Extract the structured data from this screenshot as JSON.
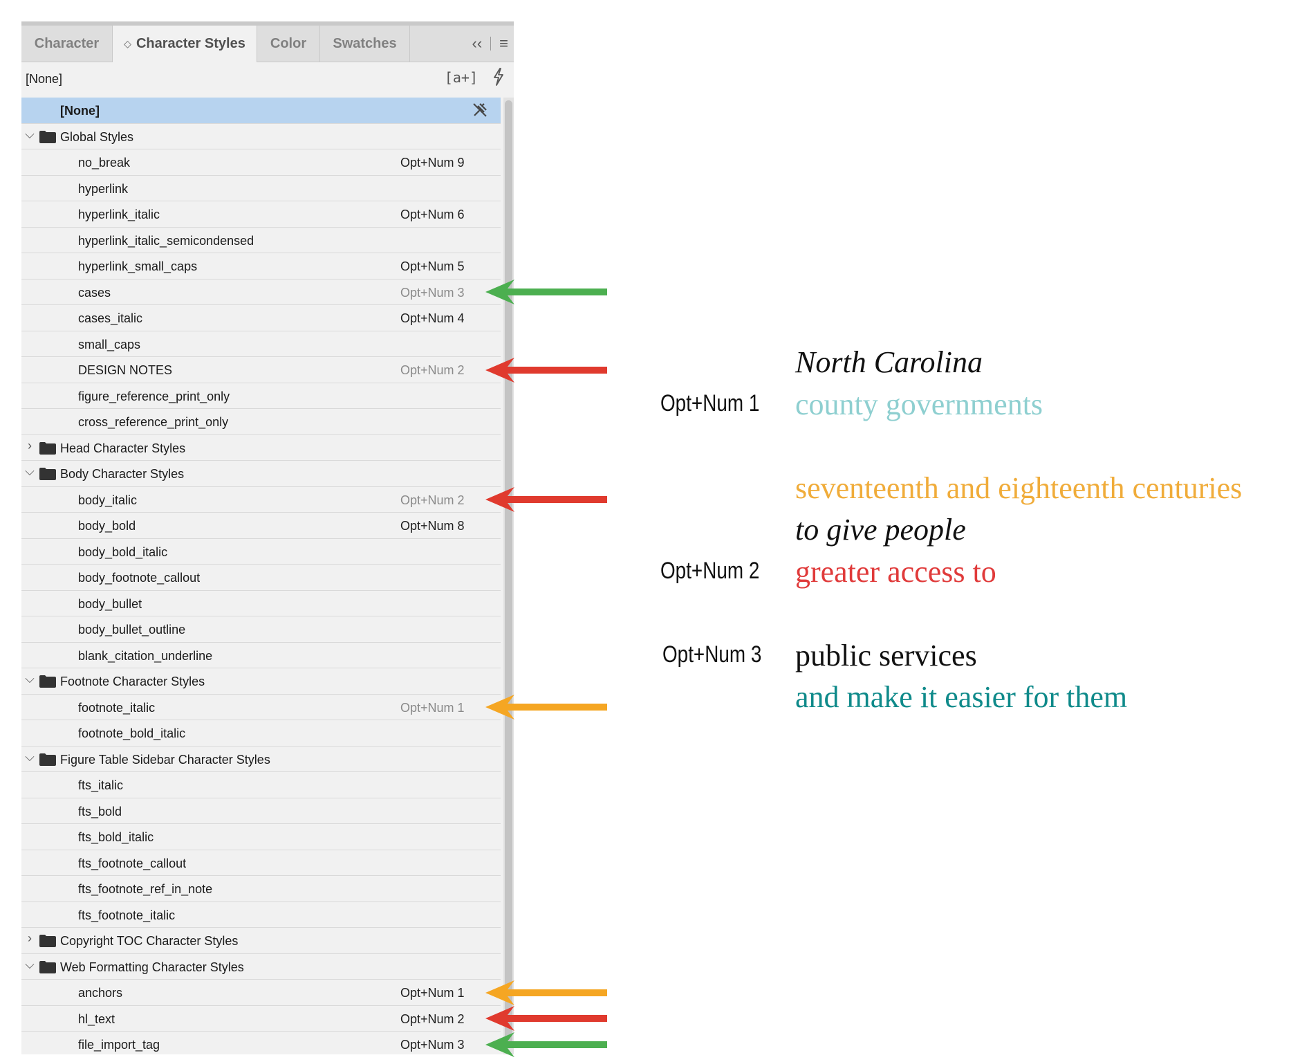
{
  "panel": {
    "tabs": [
      {
        "label": "Character",
        "active": false
      },
      {
        "label": "Character Styles",
        "active": true
      },
      {
        "label": "Color",
        "active": false
      },
      {
        "label": "Swatches",
        "active": false
      }
    ],
    "collapse_glyph": "‹‹",
    "menu_glyph": "≡",
    "current_style": "[None]",
    "new_style_glyph": "[a+]",
    "rows": [
      {
        "kind": "none",
        "label": "[None]",
        "selected": true
      },
      {
        "kind": "group",
        "label": "Global Styles",
        "expanded": true
      },
      {
        "kind": "style",
        "label": "no_break",
        "shortcut": "Opt+Num 9"
      },
      {
        "kind": "style",
        "label": "hyperlink",
        "shortcut": ""
      },
      {
        "kind": "style",
        "label": "hyperlink_italic",
        "shortcut": "Opt+Num 6"
      },
      {
        "kind": "style",
        "label": "hyperlink_italic_semicondensed",
        "shortcut": ""
      },
      {
        "kind": "style",
        "label": "hyperlink_small_caps",
        "shortcut": "Opt+Num 5"
      },
      {
        "kind": "style",
        "label": "cases",
        "shortcut": "Opt+Num 3",
        "dimmed": true
      },
      {
        "kind": "style",
        "label": "cases_italic",
        "shortcut": "Opt+Num 4"
      },
      {
        "kind": "style",
        "label": "small_caps",
        "shortcut": ""
      },
      {
        "kind": "style",
        "label": "DESIGN NOTES",
        "shortcut": "Opt+Num 2",
        "dimmed": true
      },
      {
        "kind": "style",
        "label": "figure_reference_print_only",
        "shortcut": ""
      },
      {
        "kind": "style",
        "label": "cross_reference_print_only",
        "shortcut": ""
      },
      {
        "kind": "group",
        "label": "Head Character Styles",
        "expanded": false
      },
      {
        "kind": "group",
        "label": "Body Character Styles",
        "expanded": true
      },
      {
        "kind": "style",
        "label": "body_italic",
        "shortcut": "Opt+Num 2",
        "dimmed": true
      },
      {
        "kind": "style",
        "label": "body_bold",
        "shortcut": "Opt+Num 8"
      },
      {
        "kind": "style",
        "label": "body_bold_italic",
        "shortcut": ""
      },
      {
        "kind": "style",
        "label": "body_footnote_callout",
        "shortcut": ""
      },
      {
        "kind": "style",
        "label": "body_bullet",
        "shortcut": ""
      },
      {
        "kind": "style",
        "label": "body_bullet_outline",
        "shortcut": ""
      },
      {
        "kind": "style",
        "label": "blank_citation_underline",
        "shortcut": ""
      },
      {
        "kind": "group",
        "label": "Footnote Character Styles",
        "expanded": true
      },
      {
        "kind": "style",
        "label": "footnote_italic",
        "shortcut": "Opt+Num 1",
        "dimmed": true
      },
      {
        "kind": "style",
        "label": "footnote_bold_italic",
        "shortcut": ""
      },
      {
        "kind": "group",
        "label": "Figure Table Sidebar Character Styles",
        "expanded": true
      },
      {
        "kind": "style",
        "label": "fts_italic",
        "shortcut": ""
      },
      {
        "kind": "style",
        "label": "fts_bold",
        "shortcut": ""
      },
      {
        "kind": "style",
        "label": "fts_bold_italic",
        "shortcut": ""
      },
      {
        "kind": "style",
        "label": "fts_footnote_callout",
        "shortcut": ""
      },
      {
        "kind": "style",
        "label": "fts_footnote_ref_in_note",
        "shortcut": ""
      },
      {
        "kind": "style",
        "label": "fts_footnote_italic",
        "shortcut": ""
      },
      {
        "kind": "group",
        "label": "Copyright TOC Character Styles",
        "expanded": false
      },
      {
        "kind": "group",
        "label": "Web Formatting Character Styles",
        "expanded": true
      },
      {
        "kind": "style",
        "label": "anchors",
        "shortcut": "Opt+Num 1"
      },
      {
        "kind": "style",
        "label": "hl_text",
        "shortcut": "Opt+Num 2"
      },
      {
        "kind": "style",
        "label": "file_import_tag",
        "shortcut": "Opt+Num 3"
      }
    ]
  },
  "arrows": [
    {
      "row": 7,
      "color": "#4caf50"
    },
    {
      "row": 10,
      "color": "#e03a2e"
    },
    {
      "row": 15,
      "color": "#e03a2e"
    },
    {
      "row": 23,
      "color": "#f5a623"
    },
    {
      "row": 34,
      "color": "#f5a623"
    },
    {
      "row": 35,
      "color": "#e03a2e"
    },
    {
      "row": 36,
      "color": "#4caf50"
    }
  ],
  "samples": {
    "line1": {
      "text": "North Carolina",
      "color": "#111111",
      "italic": true
    },
    "line2": {
      "text": "county governments",
      "color": "#8ecfd0",
      "key": "Opt+Num 1"
    },
    "line3": {
      "text": "seventeenth and eighteenth centuries",
      "color": "#f0ac3a"
    },
    "line4": {
      "text": "to give people",
      "color": "#111111",
      "italic": true
    },
    "line5": {
      "text": "greater access to",
      "color": "#e03a3a",
      "key": "Opt+Num 2"
    },
    "line6": {
      "text": "public services",
      "color": "#111111",
      "key": "Opt+Num 3"
    },
    "line7": {
      "text": "and make it easier for them",
      "color": "#0f8a8a"
    }
  }
}
